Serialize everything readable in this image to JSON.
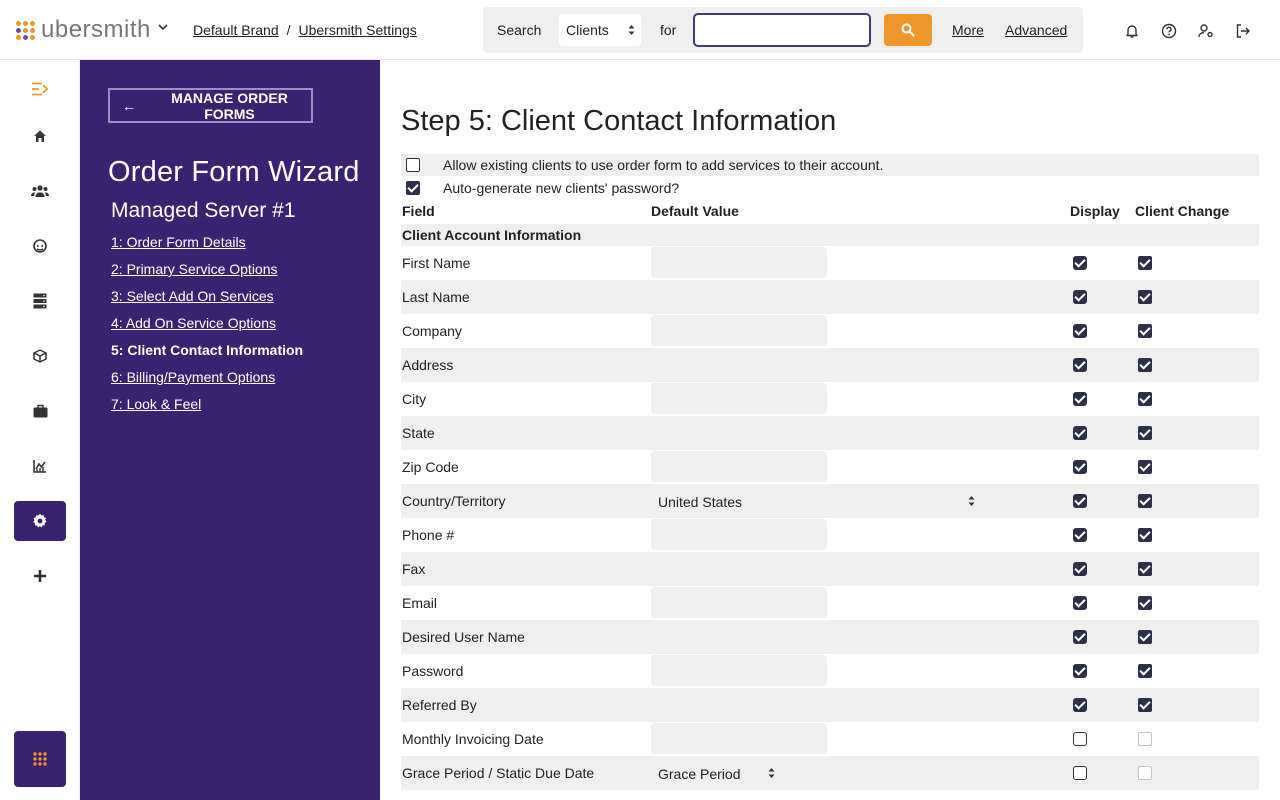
{
  "brand": {
    "logo_text": "ubersmith"
  },
  "breadcrumb": [
    {
      "label": "Default Brand"
    },
    {
      "label": "Ubersmith Settings"
    }
  ],
  "search": {
    "label": "Search",
    "scope": "Clients",
    "for_label": "for",
    "query": "",
    "more": "More",
    "advanced": "Advanced"
  },
  "sidebar": {
    "manage_button": "MANAGE ORDER FORMS",
    "title": "Order Form Wizard",
    "subtitle": "Managed Server #1",
    "steps": [
      {
        "label": "1: Order Form Details",
        "current": false
      },
      {
        "label": "2: Primary Service Options",
        "current": false
      },
      {
        "label": "3: Select Add On Services",
        "current": false
      },
      {
        "label": "4: Add On Service Options",
        "current": false
      },
      {
        "label": "5: Client Contact Information",
        "current": true
      },
      {
        "label": "6: Billing/Payment Options",
        "current": false
      },
      {
        "label": "7: Look & Feel",
        "current": false
      }
    ]
  },
  "main": {
    "title": "Step 5: Client Contact Information",
    "options": [
      {
        "label": "Allow existing clients to use order form to add services to their account.",
        "checked": false
      },
      {
        "label": "Auto-generate new clients' password?",
        "checked": true
      }
    ],
    "columns": {
      "field": "Field",
      "default": "Default Value",
      "display": "Display",
      "client_change": "Client Change"
    },
    "section": "Client Account Information",
    "rows": [
      {
        "field": "First Name",
        "type": "input",
        "display": true,
        "change": true
      },
      {
        "field": "Last Name",
        "type": "none",
        "display": true,
        "change": true
      },
      {
        "field": "Company",
        "type": "input",
        "display": true,
        "change": true
      },
      {
        "field": "Address",
        "type": "none",
        "display": true,
        "change": true
      },
      {
        "field": "City",
        "type": "input",
        "display": true,
        "change": true
      },
      {
        "field": "State",
        "type": "none",
        "display": true,
        "change": true
      },
      {
        "field": "Zip Code",
        "type": "input",
        "display": true,
        "change": true
      },
      {
        "field": "Country/Territory",
        "type": "select",
        "value": "United States",
        "display": true,
        "change": true
      },
      {
        "field": "Phone #",
        "type": "input",
        "display": true,
        "change": true
      },
      {
        "field": "Fax",
        "type": "none",
        "display": true,
        "change": true
      },
      {
        "field": "Email",
        "type": "input",
        "display": true,
        "change": true
      },
      {
        "field": "Desired User Name",
        "type": "none",
        "display": true,
        "change": true
      },
      {
        "field": "Password",
        "type": "input",
        "display": true,
        "change": true
      },
      {
        "field": "Referred By",
        "type": "none",
        "display": true,
        "change": true
      },
      {
        "field": "Monthly Invoicing Date",
        "type": "input",
        "display": false,
        "change": false
      },
      {
        "field": "Grace Period / Static Due Date",
        "type": "select",
        "value": "Grace Period",
        "display": false,
        "change": false
      }
    ]
  },
  "colors": {
    "accent": "#f0962a",
    "sidebar": "#3b2270",
    "checkbox": "#2c3149"
  }
}
